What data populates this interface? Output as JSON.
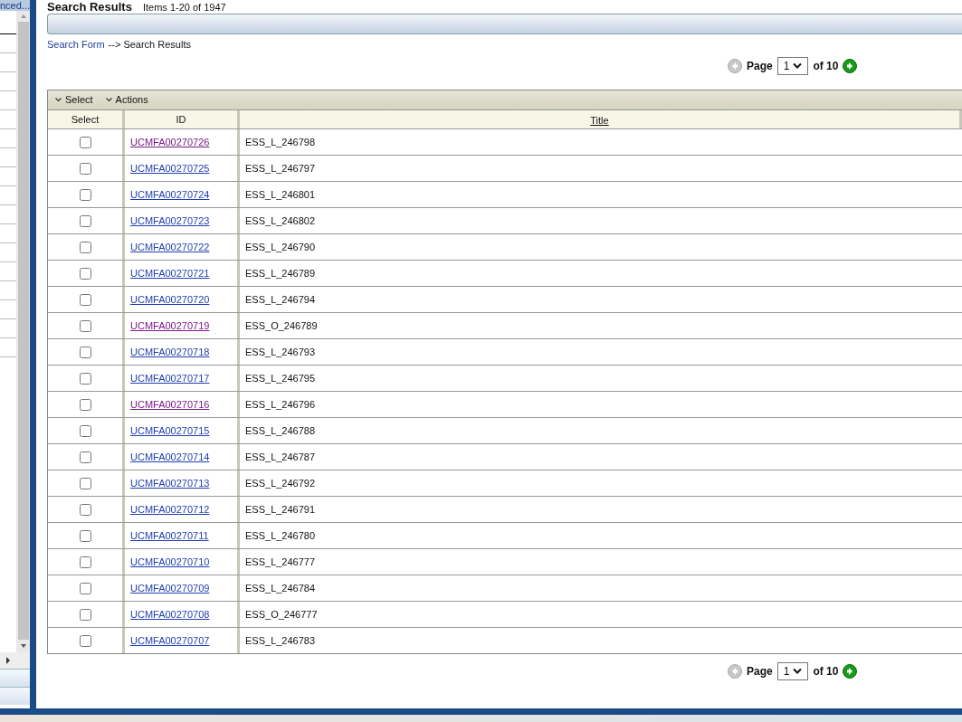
{
  "side_panel": {
    "tab_label": "nced..."
  },
  "header": {
    "title": "Search Results",
    "count": "Items 1-20 of 1947"
  },
  "breadcrumb": {
    "link": "Search Form",
    "rest": "--> Search Results"
  },
  "pager_top": {
    "label": "Page",
    "page": "1",
    "of": "of 10"
  },
  "toolbar": [
    "Select",
    "Actions"
  ],
  "columns": [
    "Select",
    "ID",
    "Title"
  ],
  "rows": [
    {
      "checked": false,
      "id": "UCMFA00270726",
      "visited": true,
      "title": "ESS_L_246798"
    },
    {
      "checked": false,
      "id": "UCMFA00270725",
      "visited": false,
      "title": "ESS_L_246797"
    },
    {
      "checked": false,
      "id": "UCMFA00270724",
      "visited": false,
      "title": "ESS_L_246801"
    },
    {
      "checked": false,
      "id": "UCMFA00270723",
      "visited": false,
      "title": "ESS_L_246802"
    },
    {
      "checked": false,
      "id": "UCMFA00270722",
      "visited": false,
      "title": "ESS_L_246790"
    },
    {
      "checked": false,
      "id": "UCMFA00270721",
      "visited": false,
      "title": "ESS_L_246789"
    },
    {
      "checked": false,
      "id": "UCMFA00270720",
      "visited": false,
      "title": "ESS_L_246794"
    },
    {
      "checked": false,
      "id": "UCMFA00270719",
      "visited": true,
      "title": "ESS_O_246789"
    },
    {
      "checked": false,
      "id": "UCMFA00270718",
      "visited": false,
      "title": "ESS_L_246793"
    },
    {
      "checked": false,
      "id": "UCMFA00270717",
      "visited": false,
      "title": "ESS_L_246795"
    },
    {
      "checked": false,
      "id": "UCMFA00270716",
      "visited": true,
      "title": "ESS_L_246796"
    },
    {
      "checked": false,
      "id": "UCMFA00270715",
      "visited": false,
      "title": "ESS_L_246788"
    },
    {
      "checked": false,
      "id": "UCMFA00270714",
      "visited": false,
      "title": "ESS_L_246787"
    },
    {
      "checked": false,
      "id": "UCMFA00270713",
      "visited": false,
      "title": "ESS_L_246792"
    },
    {
      "checked": false,
      "id": "UCMFA00270712",
      "visited": false,
      "title": "ESS_L_246791"
    },
    {
      "checked": false,
      "id": "UCMFA00270711",
      "visited": false,
      "title": "ESS_L_246780"
    },
    {
      "checked": false,
      "id": "UCMFA00270710",
      "visited": false,
      "title": "ESS_L_246777"
    },
    {
      "checked": false,
      "id": "UCMFA00270709",
      "visited": false,
      "title": "ESS_L_246784"
    },
    {
      "checked": false,
      "id": "UCMFA00270708",
      "visited": false,
      "title": "ESS_O_246777"
    },
    {
      "checked": false,
      "id": "UCMFA00270707",
      "visited": false,
      "title": "ESS_L_246783"
    }
  ],
  "pager_bottom": {
    "label": "Page",
    "page": "1",
    "of": "of 10"
  }
}
